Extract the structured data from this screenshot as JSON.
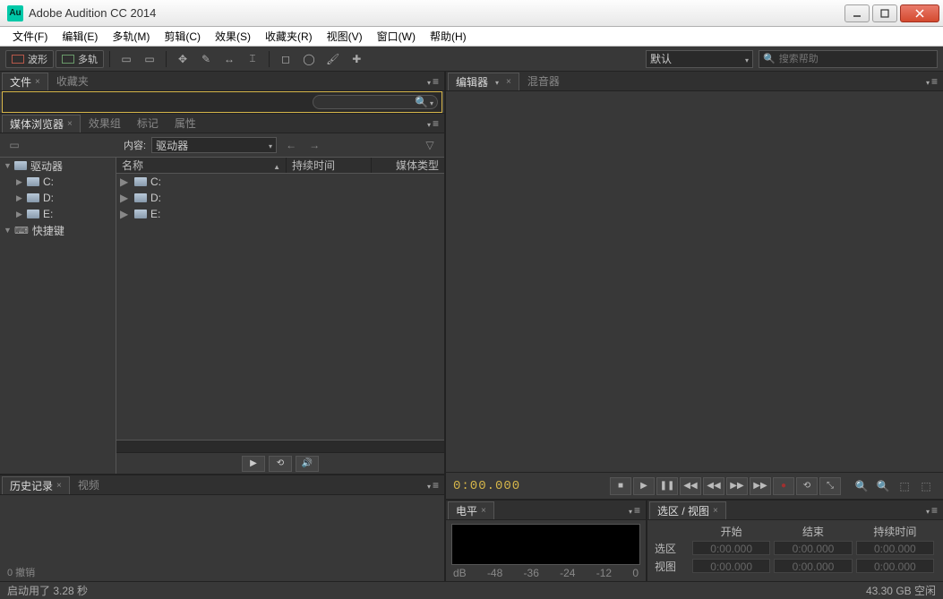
{
  "window": {
    "title": "Adobe Audition CC 2014",
    "app_icon_label": "Au"
  },
  "menu": [
    "文件(F)",
    "编辑(E)",
    "多轨(M)",
    "剪辑(C)",
    "效果(S)",
    "收藏夹(R)",
    "视图(V)",
    "窗口(W)",
    "帮助(H)"
  ],
  "toolbar": {
    "view_wave": "波形",
    "view_multi": "多轨",
    "workspace": "默认",
    "search_placeholder": "搜索帮助"
  },
  "files_panel": {
    "tab_files": "文件",
    "tab_favorites": "收藏夹"
  },
  "media_browser": {
    "tab_media": "媒体浏览器",
    "tab_effects": "效果组",
    "tab_markers": "标记",
    "tab_properties": "属性",
    "content_label": "内容:",
    "content_select": "驱动器",
    "col_name": "名称",
    "col_duration": "持续时间",
    "col_mediatype": "媒体类型",
    "tree": {
      "drives_root": "驱动器",
      "drives": [
        "C:",
        "D:",
        "E:"
      ],
      "shortcuts": "快捷键"
    },
    "list_drives": [
      "C:",
      "D:",
      "E:"
    ]
  },
  "history": {
    "tab_history": "历史记录",
    "tab_video": "视频",
    "undo_label": "0 撤销"
  },
  "editor": {
    "tab_editor": "编辑器",
    "tab_mixer": "混音器",
    "time": "0:00.000"
  },
  "levels": {
    "tab": "电平",
    "scale": [
      "dB",
      "-48",
      "-36",
      "-24",
      "-12",
      "0"
    ]
  },
  "selview": {
    "tab": "选区 / 视图",
    "col_start": "开始",
    "col_end": "结束",
    "col_duration": "持续时间",
    "row_sel": "选区",
    "row_view": "视图",
    "zero": "0:00.000"
  },
  "status": {
    "left": "启动用了 3.28 秒",
    "right": "43.30 GB 空闲"
  }
}
